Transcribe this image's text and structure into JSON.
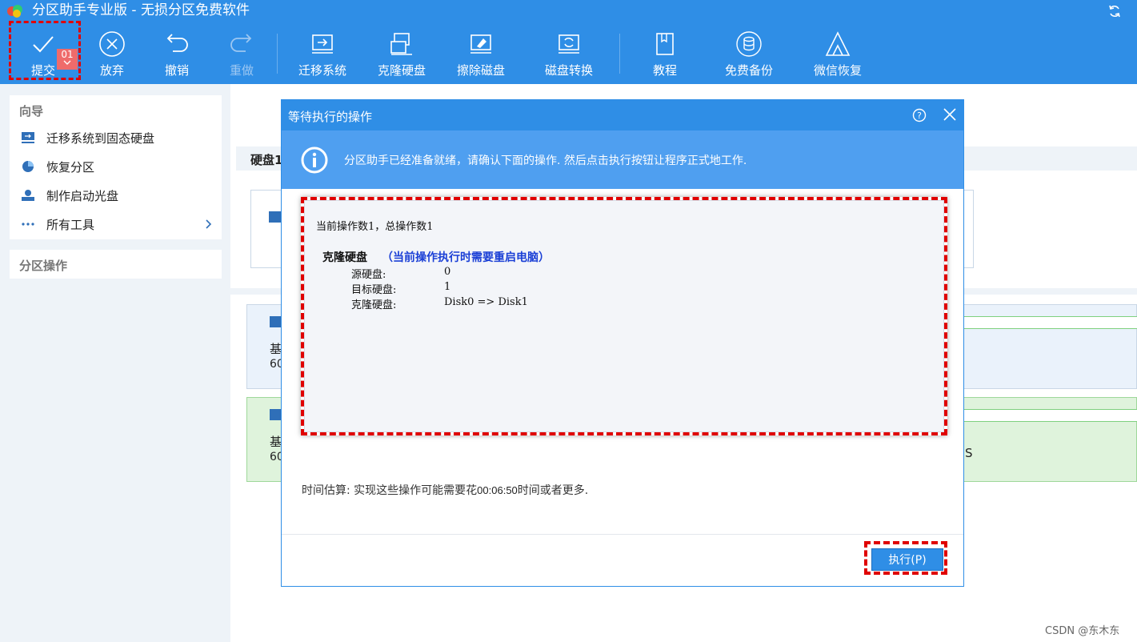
{
  "window": {
    "title": "分区助手专业版 - 无损分区免费软件"
  },
  "toolbar": {
    "badge": "01",
    "items": [
      {
        "label": "提交"
      },
      {
        "label": "放弃"
      },
      {
        "label": "撤销"
      },
      {
        "label": "重做"
      },
      {
        "label": "迁移系统"
      },
      {
        "label": "克隆硬盘"
      },
      {
        "label": "擦除磁盘"
      },
      {
        "label": "磁盘转换"
      },
      {
        "label": "教程"
      },
      {
        "label": "免费备份"
      },
      {
        "label": "微信恢复"
      }
    ]
  },
  "sidebar": {
    "wizard_title": "向导",
    "wizard_items": [
      {
        "label": "迁移系统到固态硬盘"
      },
      {
        "label": "恢复分区"
      },
      {
        "label": "制作启动光盘"
      },
      {
        "label": "所有工具"
      }
    ],
    "partition_ops_title": "分区操作"
  },
  "background": {
    "disk_header": "硬盘1",
    "row1_line1": "基",
    "row1_line2": "60",
    "row2_line1": "基",
    "row2_line2": "60",
    "row2_right": "S"
  },
  "dialog": {
    "title": "等待执行的操作",
    "info": "分区助手已经准备就绪，请确认下面的操作. 然后点击执行按钮让程序正式地工作.",
    "op_count": "当前操作数1，总操作数1",
    "op_name": "克隆硬盘",
    "op_note": "（当前操作执行时需要重启电脑）",
    "details": [
      {
        "key": "源硬盘:",
        "value": "0"
      },
      {
        "key": "目标硬盘:",
        "value": "1"
      },
      {
        "key": "克隆硬盘:",
        "value": "Disk0 => Disk1"
      }
    ],
    "estimate_prefix": "时间估算: 实现这些操作可能需要花",
    "estimate_time": "00:06:50",
    "estimate_suffix": "时间或者更多.",
    "execute_label": "执行(P)"
  },
  "watermark": "CSDN @东木东",
  "colors": {
    "accent": "#2f8ee6",
    "highlight": "#e00000",
    "note": "#1a3fd6"
  }
}
